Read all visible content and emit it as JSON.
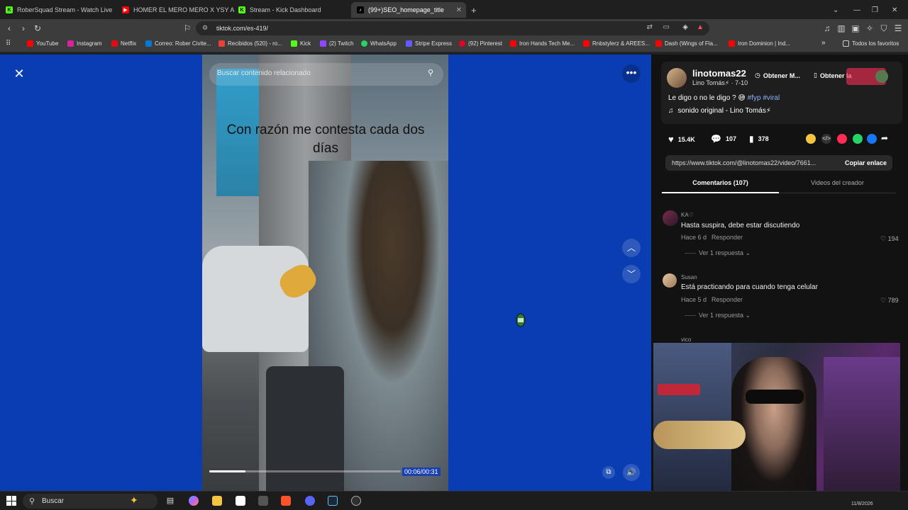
{
  "tabs": [
    {
      "title": "RoberSquad Stream - Watch Live",
      "icon_color": "#53fc18",
      "icon_letter": "K"
    },
    {
      "title": "HOMER EL MERO MERO X YSY A - D",
      "icon_color": "#ff0000",
      "icon_letter": "▶"
    },
    {
      "title": "Stream - Kick Dashboard",
      "icon_color": "#53fc18",
      "icon_letter": "K"
    },
    {
      "title": "(99+)SEO_homepage_title",
      "icon_color": "#222",
      "icon_letter": "♪"
    }
  ],
  "toolbar": {
    "url": "tiktok.com/es-419/"
  },
  "bookmarks": [
    {
      "label": "YouTube",
      "color": "#ff0000"
    },
    {
      "label": "Instagram",
      "color": "#d6249f"
    },
    {
      "label": "Netflix",
      "color": "#e50914"
    },
    {
      "label": "Correo: Rober Civite...",
      "color": "#0078d4"
    },
    {
      "label": "Recibidos (520) - ro...",
      "color": "#ea4335"
    },
    {
      "label": "Kick",
      "color": "#53fc18"
    },
    {
      "label": "(2) Twitch",
      "color": "#9146ff"
    },
    {
      "label": "WhatsApp",
      "color": "#25d366"
    },
    {
      "label": "Stripe Express",
      "color": "#635bff"
    },
    {
      "label": "(92) Pinterest",
      "color": "#e60023"
    },
    {
      "label": "Iron Hands Tech Me...",
      "color": "#ff0000"
    },
    {
      "label": "Rnbstylerz & AREES...",
      "color": "#ff0000"
    },
    {
      "label": "Dash (Wings of Fla...",
      "color": "#ff0000"
    },
    {
      "label": "Iron Dominion | Ind...",
      "color": "#ff0000"
    }
  ],
  "bookmarks_all": "Todos los favoritos",
  "video": {
    "search_placeholder": "Buscar contenido relacionado",
    "caption": "Con razón me contesta cada dos días",
    "timecode": "00:06/00:31",
    "progress": 0.19
  },
  "creator": {
    "username": "linotomas22",
    "display": "Lino Tomás⚡ · 7-10",
    "btn_obtener_m": "Obtener M...",
    "btn_obtener_la": "Obtener la",
    "description": "Le digo o no le digo ?",
    "hashtags": "#fyp #viral",
    "sound": "sonido original - Lino Tomás⚡"
  },
  "actions": {
    "likes": "15.4K",
    "comments": "107",
    "saves": "378"
  },
  "link": {
    "url": "https://www.tiktok.com/@linotomas22/video/7661...",
    "copy_label": "Copiar enlace"
  },
  "panel_tabs": {
    "comments": "Comentarios (107)",
    "creator_videos": "Videos del creador"
  },
  "comments": [
    {
      "user": "KA♡",
      "text": "Hasta suspira, debe estar discutiendo",
      "age": "Hace 6 d",
      "reply": "Responder",
      "likes": "194",
      "replies": "Ver 1 respuesta"
    },
    {
      "user": "Susan",
      "text": "Está practicando para cuando tenga celular",
      "age": "Hace 5 d",
      "reply": "Responder",
      "likes": "789",
      "replies": "Ver 1 respuesta"
    },
    {
      "user": "vico"
    }
  ],
  "taskbar": {
    "search": "Buscar",
    "date": "11/8/2026"
  }
}
